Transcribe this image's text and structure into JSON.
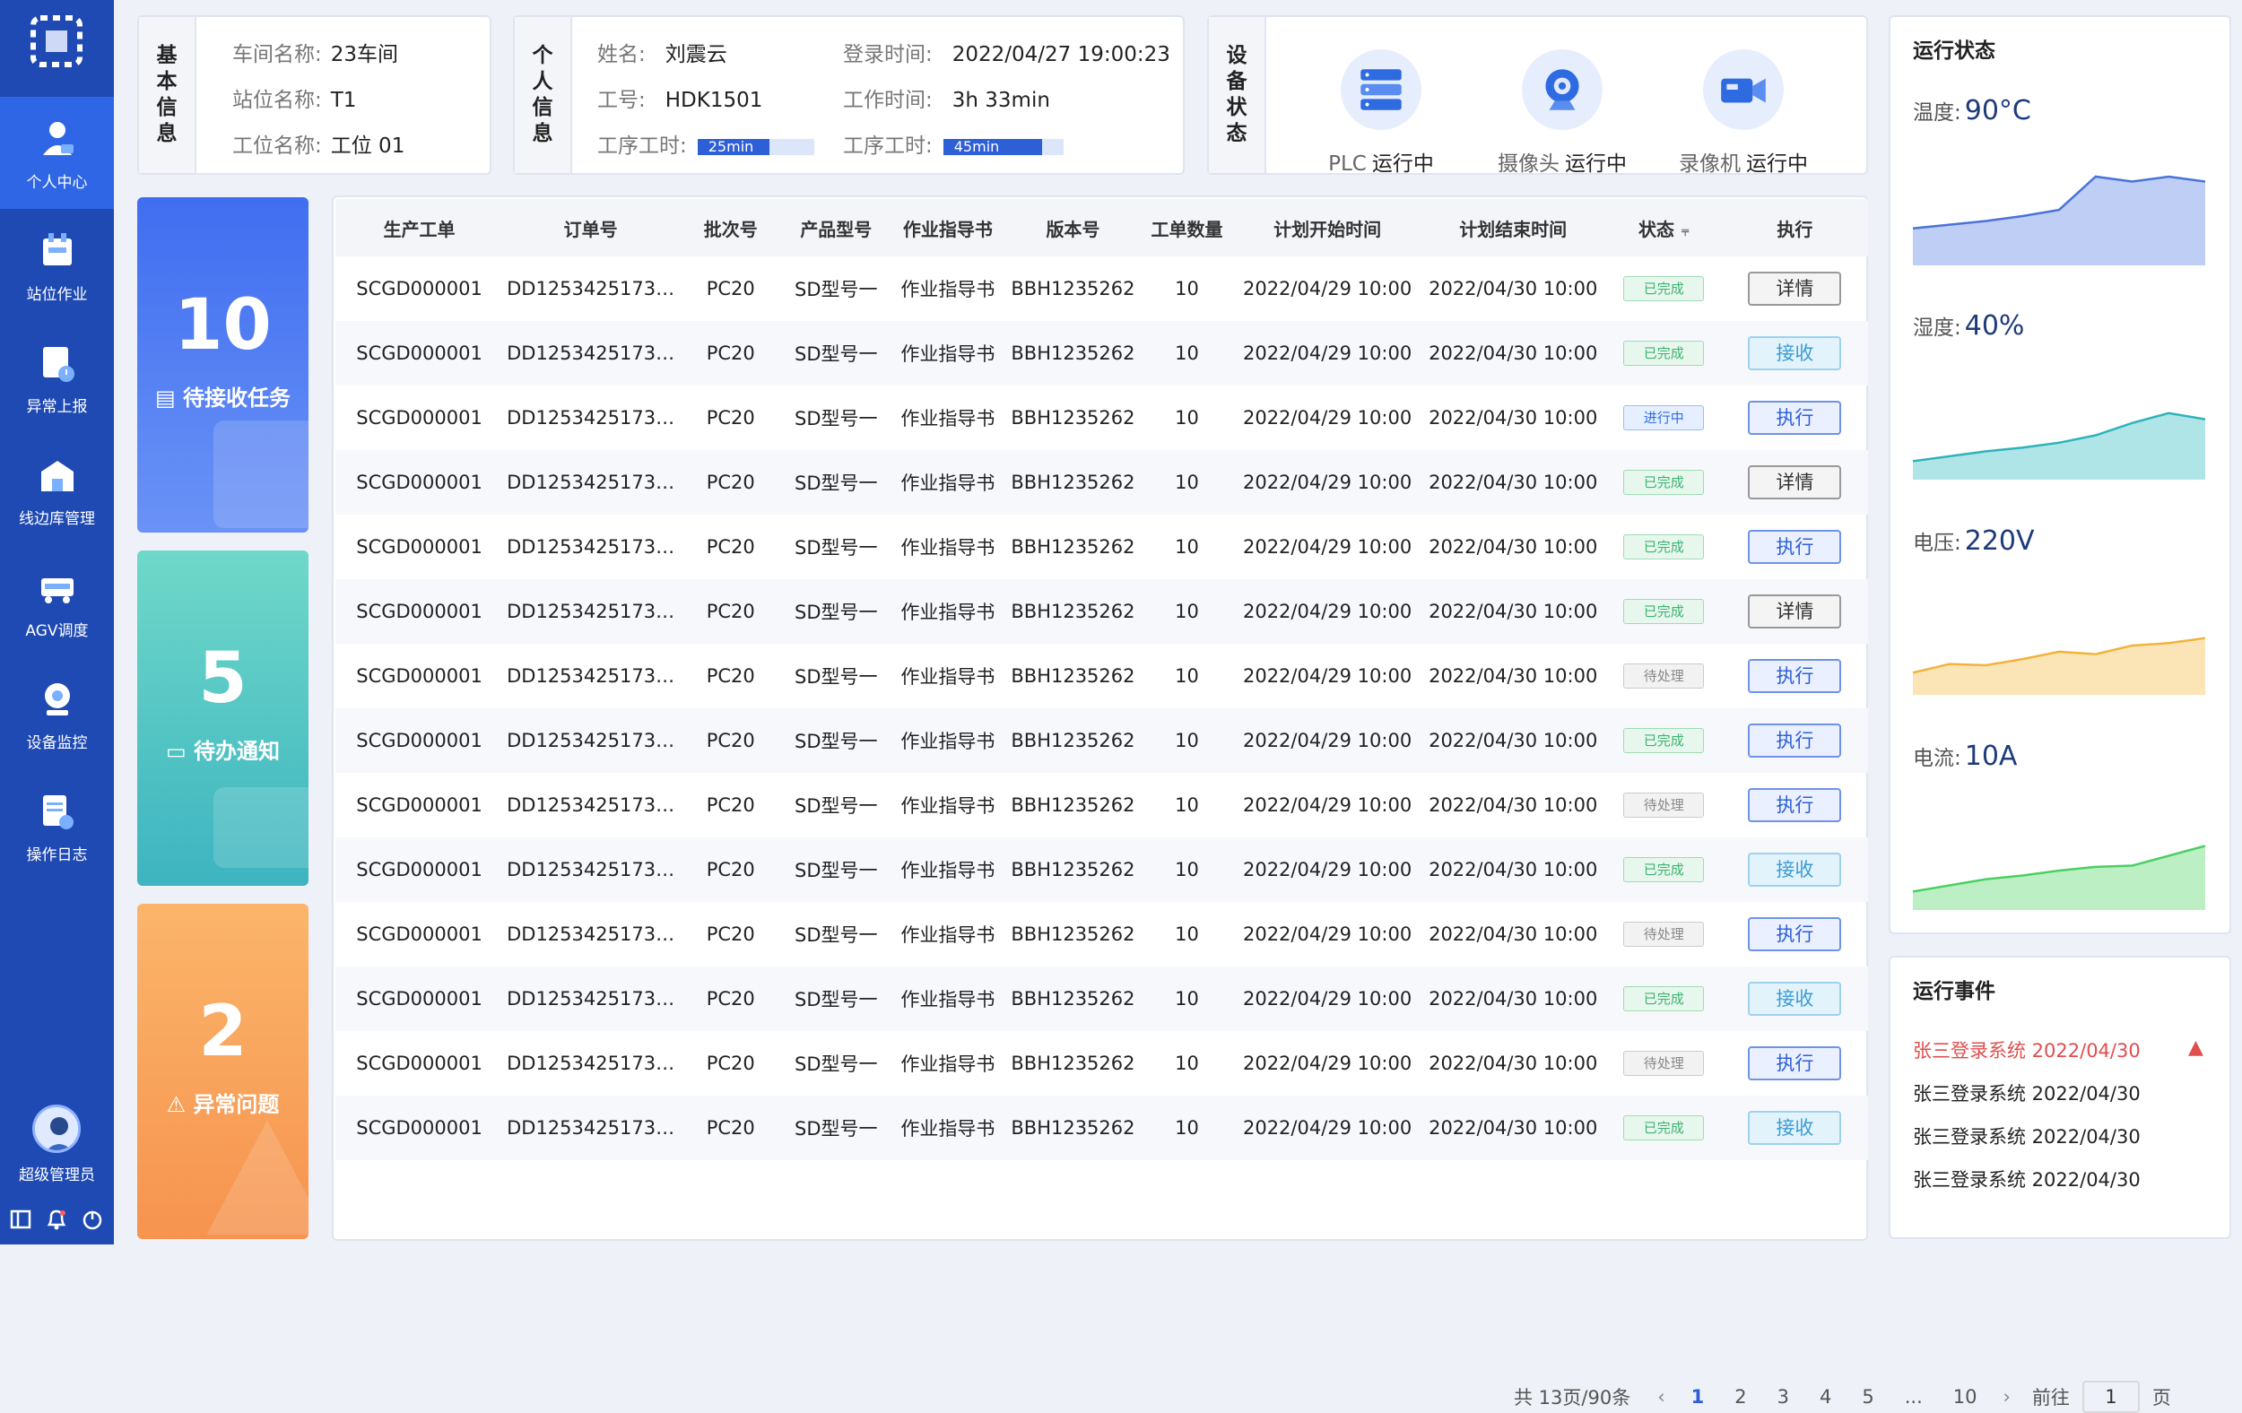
{
  "sidebar": {
    "items": [
      {
        "label": "个人中心",
        "icon": "user-center-icon",
        "active": true
      },
      {
        "label": "站位作业",
        "icon": "station-work-icon"
      },
      {
        "label": "异常上报",
        "icon": "exception-report-icon"
      },
      {
        "label": "线边库管理",
        "icon": "warehouse-icon"
      },
      {
        "label": "AGV调度",
        "icon": "agv-icon"
      },
      {
        "label": "设备监控",
        "icon": "device-monitor-icon"
      },
      {
        "label": "操作日志",
        "icon": "operation-log-icon"
      }
    ],
    "user": "超级管理员"
  },
  "basic_info": {
    "title": "基本信息",
    "workshop_label": "车间名称:",
    "workshop": "23车间",
    "station_label": "站位名称:",
    "station": "T1",
    "position_label": "工位名称:",
    "position": "工位 01"
  },
  "personal_info": {
    "title": "个人信息",
    "name_label": "姓名:",
    "name": "刘震云",
    "id_label": "工号:",
    "id": "HDK1501",
    "hours1_label": "工序工时:",
    "hours1": "25min",
    "hours1_progress": 0.62,
    "login_label": "登录时间:",
    "login": "2022/04/27 19:00:23",
    "worktime_label": "工作时间:",
    "worktime": "3h 33min",
    "hours2_label": "工序工时:",
    "hours2": "45min",
    "hours2_progress": 0.82
  },
  "device_status": {
    "title": "设备状态",
    "devices": [
      {
        "name": "PLC",
        "status": "运行中",
        "icon": "server-icon"
      },
      {
        "name": "摄像头",
        "status": "运行中",
        "icon": "camera-icon"
      },
      {
        "name": "录像机",
        "status": "运行中",
        "icon": "video-recorder-icon"
      }
    ]
  },
  "summary": [
    {
      "count": "10",
      "label": "待接收任务",
      "color_from": "#3f6ef0",
      "color_to": "#6a92f6"
    },
    {
      "count": "5",
      "label": "待办通知",
      "color_from": "#6fd8c9",
      "color_to": "#3db4c0"
    },
    {
      "count": "2",
      "label": "异常问题",
      "color_from": "#fbb56a",
      "color_to": "#f6934f"
    }
  ],
  "table": {
    "headers": [
      "生产工单",
      "订单号",
      "批次号",
      "产品型号",
      "作业指导书",
      "版本号",
      "工单数量",
      "计划开始时间",
      "计划结束时间",
      "状态",
      "执行"
    ],
    "rows": [
      [
        "SCGD000001",
        "DD1253425173612...",
        "PC20",
        "SD型号一",
        "作业指导书",
        "BBH1235262",
        "10",
        "2022/04/29 10:00",
        "2022/04/30 10:00",
        "已完成",
        "详情"
      ],
      [
        "SCGD000001",
        "DD1253425173612...",
        "PC20",
        "SD型号一",
        "作业指导书",
        "BBH1235262",
        "10",
        "2022/04/29 10:00",
        "2022/04/30 10:00",
        "已完成",
        "接收"
      ],
      [
        "SCGD000001",
        "DD1253425173612...",
        "PC20",
        "SD型号一",
        "作业指导书",
        "BBH1235262",
        "10",
        "2022/04/29 10:00",
        "2022/04/30 10:00",
        "进行中",
        "执行"
      ],
      [
        "SCGD000001",
        "DD1253425173612...",
        "PC20",
        "SD型号一",
        "作业指导书",
        "BBH1235262",
        "10",
        "2022/04/29 10:00",
        "2022/04/30 10:00",
        "已完成",
        "详情"
      ],
      [
        "SCGD000001",
        "DD1253425173612...",
        "PC20",
        "SD型号一",
        "作业指导书",
        "BBH1235262",
        "10",
        "2022/04/29 10:00",
        "2022/04/30 10:00",
        "已完成",
        "执行"
      ],
      [
        "SCGD000001",
        "DD1253425173612...",
        "PC20",
        "SD型号一",
        "作业指导书",
        "BBH1235262",
        "10",
        "2022/04/29 10:00",
        "2022/04/30 10:00",
        "已完成",
        "详情"
      ],
      [
        "SCGD000001",
        "DD1253425173612...",
        "PC20",
        "SD型号一",
        "作业指导书",
        "BBH1235262",
        "10",
        "2022/04/29 10:00",
        "2022/04/30 10:00",
        "待处理",
        "执行"
      ],
      [
        "SCGD000001",
        "DD1253425173612...",
        "PC20",
        "SD型号一",
        "作业指导书",
        "BBH1235262",
        "10",
        "2022/04/29 10:00",
        "2022/04/30 10:00",
        "已完成",
        "执行"
      ],
      [
        "SCGD000001",
        "DD1253425173612...",
        "PC20",
        "SD型号一",
        "作业指导书",
        "BBH1235262",
        "10",
        "2022/04/29 10:00",
        "2022/04/30 10:00",
        "待处理",
        "执行"
      ],
      [
        "SCGD000001",
        "DD1253425173612...",
        "PC20",
        "SD型号一",
        "作业指导书",
        "BBH1235262",
        "10",
        "2022/04/29 10:00",
        "2022/04/30 10:00",
        "已完成",
        "接收"
      ],
      [
        "SCGD000001",
        "DD1253425173612...",
        "PC20",
        "SD型号一",
        "作业指导书",
        "BBH1235262",
        "10",
        "2022/04/29 10:00",
        "2022/04/30 10:00",
        "待处理",
        "执行"
      ],
      [
        "SCGD000001",
        "DD1253425173612...",
        "PC20",
        "SD型号一",
        "作业指导书",
        "BBH1235262",
        "10",
        "2022/04/29 10:00",
        "2022/04/30 10:00",
        "已完成",
        "接收"
      ],
      [
        "SCGD000001",
        "DD1253425173612...",
        "PC20",
        "SD型号一",
        "作业指导书",
        "BBH1235262",
        "10",
        "2022/04/29 10:00",
        "2022/04/30 10:00",
        "待处理",
        "执行"
      ],
      [
        "SCGD000001",
        "DD1253425173612...",
        "PC20",
        "SD型号一",
        "作业指导书",
        "BBH1235262",
        "10",
        "2022/04/29 10:00",
        "2022/04/30 10:00",
        "已完成",
        "接收"
      ]
    ]
  },
  "pagination": {
    "total": "共 13页/90条",
    "pages": [
      "1",
      "2",
      "3",
      "4",
      "5",
      "...",
      "10"
    ],
    "current": "1",
    "goto_label": "前往",
    "goto_value": "1",
    "page_suffix": "页"
  },
  "run_status": {
    "title": "运行状态",
    "metrics": [
      {
        "label": "温度:",
        "value": "90°C",
        "color": "#4a72d8",
        "fill": "#6f92e6"
      },
      {
        "label": "湿度:",
        "value": "40%",
        "color": "#2fb3ba",
        "fill": "#4dc6c8"
      },
      {
        "label": "电压:",
        "value": "220V",
        "color": "#f2b33c",
        "fill": "#f6c660"
      },
      {
        "label": "电流:",
        "value": "10A",
        "color": "#4ccf63",
        "fill": "#6bdc7c"
      }
    ]
  },
  "chart_data": [
    {
      "type": "area",
      "values": [
        30,
        33,
        36,
        40,
        45,
        72,
        68,
        72,
        68
      ],
      "title": "",
      "xlabel": "",
      "ylabel": ""
    },
    {
      "type": "area",
      "values": [
        15,
        19,
        23,
        26,
        30,
        36,
        46,
        54,
        49
      ],
      "title": "",
      "xlabel": "",
      "ylabel": ""
    },
    {
      "type": "area",
      "values": [
        18,
        25,
        24,
        29,
        35,
        33,
        40,
        42,
        46
      ],
      "title": "",
      "xlabel": "",
      "ylabel": ""
    },
    {
      "type": "area",
      "values": [
        15,
        20,
        25,
        28,
        32,
        35,
        36,
        44,
        52
      ],
      "title": "",
      "xlabel": "",
      "ylabel": ""
    }
  ],
  "run_events": {
    "title": "运行事件",
    "items": [
      {
        "text": "张三登录系统 2022/04/30",
        "alert": true
      },
      {
        "text": "张三登录系统 2022/04/30",
        "alert": false
      },
      {
        "text": "张三登录系统 2022/04/30",
        "alert": false
      },
      {
        "text": "张三登录系统 2022/04/30",
        "alert": false
      }
    ]
  }
}
